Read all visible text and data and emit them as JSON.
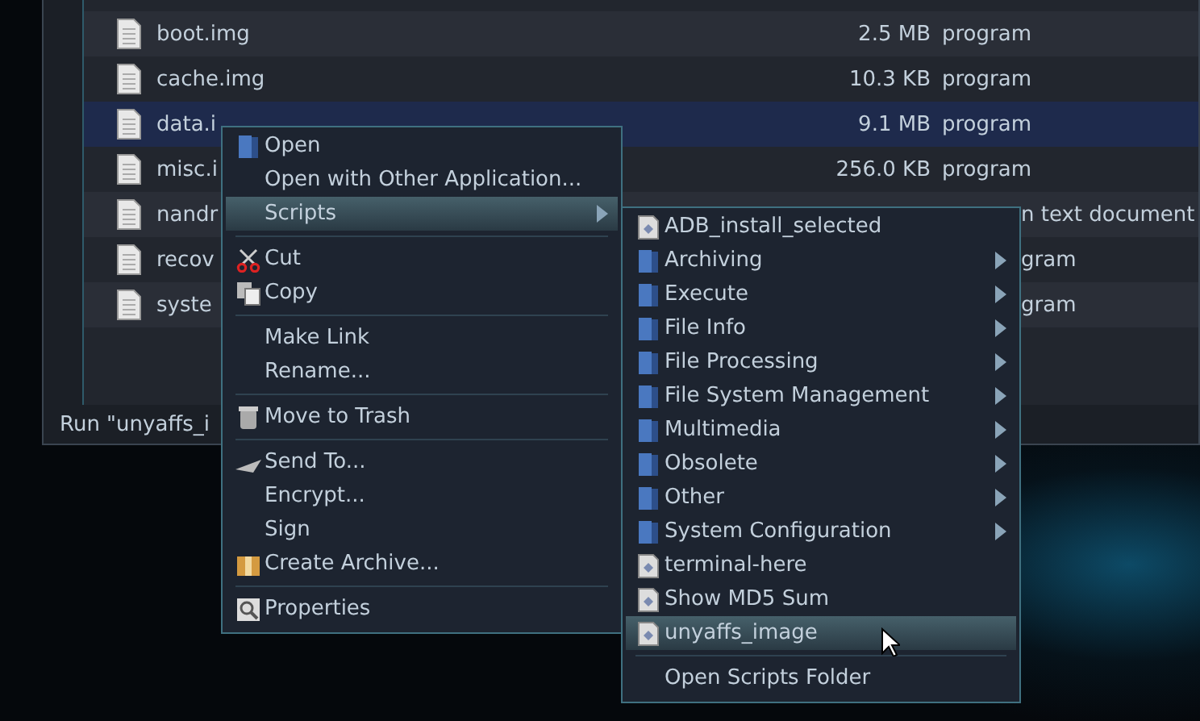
{
  "files": [
    {
      "name": "boot.img",
      "size": "2.5 MB",
      "type": "program",
      "selected": false
    },
    {
      "name": "cache.img",
      "size": "10.3 KB",
      "type": "program",
      "selected": false
    },
    {
      "name": "data.i",
      "size": "9.1 MB",
      "type": "program",
      "selected": true
    },
    {
      "name": "misc.i",
      "size": "256.0 KB",
      "type": "program",
      "selected": false
    },
    {
      "name": "nandr",
      "type": "n text document",
      "selected": false
    },
    {
      "name": "recov",
      "type": "gram",
      "selected": false
    },
    {
      "name": "syste",
      "type": "gram",
      "selected": false
    }
  ],
  "status_text": "Run \"unyaffs_i",
  "context_menu": [
    {
      "kind": "item",
      "label": "Open",
      "selected": false
    },
    {
      "kind": "item",
      "label": "Open with Other Application...",
      "selected": false
    },
    {
      "kind": "submenu",
      "label": "Scripts",
      "selected": true
    },
    {
      "kind": "separator"
    },
    {
      "kind": "item",
      "label": "Cut",
      "selected": false
    },
    {
      "kind": "item",
      "label": "Copy",
      "selected": false
    },
    {
      "kind": "separator"
    },
    {
      "kind": "item",
      "label": "Make Link",
      "selected": false
    },
    {
      "kind": "item",
      "label": "Rename...",
      "selected": false
    },
    {
      "kind": "separator"
    },
    {
      "kind": "item",
      "label": "Move to Trash",
      "selected": false
    },
    {
      "kind": "separator"
    },
    {
      "kind": "item",
      "label": "Send To...",
      "selected": false
    },
    {
      "kind": "item",
      "label": "Encrypt...",
      "selected": false
    },
    {
      "kind": "item",
      "label": "Sign",
      "selected": false
    },
    {
      "kind": "item",
      "label": "Create Archive...",
      "selected": false
    },
    {
      "kind": "separator"
    },
    {
      "kind": "item",
      "label": "Properties",
      "selected": false
    }
  ],
  "scripts_menu": [
    {
      "kind": "script",
      "label": "ADB_install_selected",
      "selected": false
    },
    {
      "kind": "folder",
      "label": "Archiving",
      "selected": false
    },
    {
      "kind": "folder",
      "label": "Execute",
      "selected": false
    },
    {
      "kind": "folder",
      "label": "File Info",
      "selected": false
    },
    {
      "kind": "folder",
      "label": "File Processing",
      "selected": false
    },
    {
      "kind": "folder",
      "label": "File System Management",
      "selected": false
    },
    {
      "kind": "folder",
      "label": "Multimedia",
      "selected": false
    },
    {
      "kind": "folder",
      "label": "Obsolete",
      "selected": false
    },
    {
      "kind": "folder",
      "label": "Other",
      "selected": false
    },
    {
      "kind": "folder",
      "label": "System Configuration",
      "selected": false
    },
    {
      "kind": "script",
      "label": "terminal-here",
      "selected": false
    },
    {
      "kind": "script",
      "label": "Show MD5 Sum",
      "selected": false
    },
    {
      "kind": "script",
      "label": "unyaffs_image",
      "selected": true
    },
    {
      "kind": "separator"
    },
    {
      "kind": "action",
      "label": "Open Scripts Folder",
      "selected": false
    }
  ]
}
